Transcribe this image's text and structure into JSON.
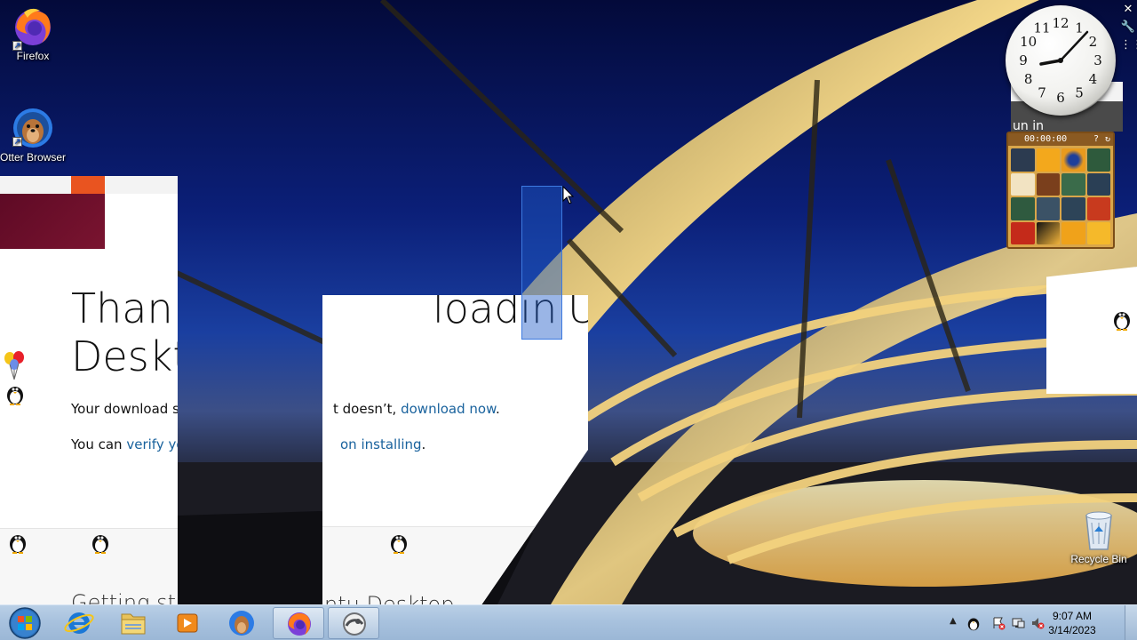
{
  "desktop": {
    "icons": [
      {
        "name": "firefox",
        "label": "Firefox"
      },
      {
        "name": "otter-browser",
        "label": "Otter Browser"
      },
      {
        "name": "recycle-bin",
        "label": "Recycle Bin"
      }
    ]
  },
  "ghost_page": {
    "heading_line1": "Thank",
    "heading_line1_b": "loadin",
    "heading_line1_c": "U",
    "heading_line2": "Deskt",
    "line1_prefix": "Your download s",
    "line1_mid": "t doesn’t,",
    "line1_link": "download now",
    "line1_end": ".",
    "line2_prefix": "You can",
    "line2_link": "verify yo",
    "line2_link2": "on installing",
    "line2_end": ".",
    "footer_a": "Getting st",
    "footer_b": "ntu Desktop",
    "gadget_fragment": "un in"
  },
  "gadgets": {
    "clock_hours": [
      "12",
      "1",
      "2",
      "3",
      "4",
      "5",
      "6",
      "7",
      "8",
      "9",
      "10",
      "11"
    ],
    "puzzle_timer": "00:00:00"
  },
  "taskbar": {
    "time": "9:07 AM",
    "date": "3/14/2023"
  },
  "colors": {
    "ubuntu_orange": "#e95420",
    "ubuntu_aubergine": "#5e0a25",
    "link_blue": "#19629d",
    "taskbar": "#a8c2de"
  }
}
